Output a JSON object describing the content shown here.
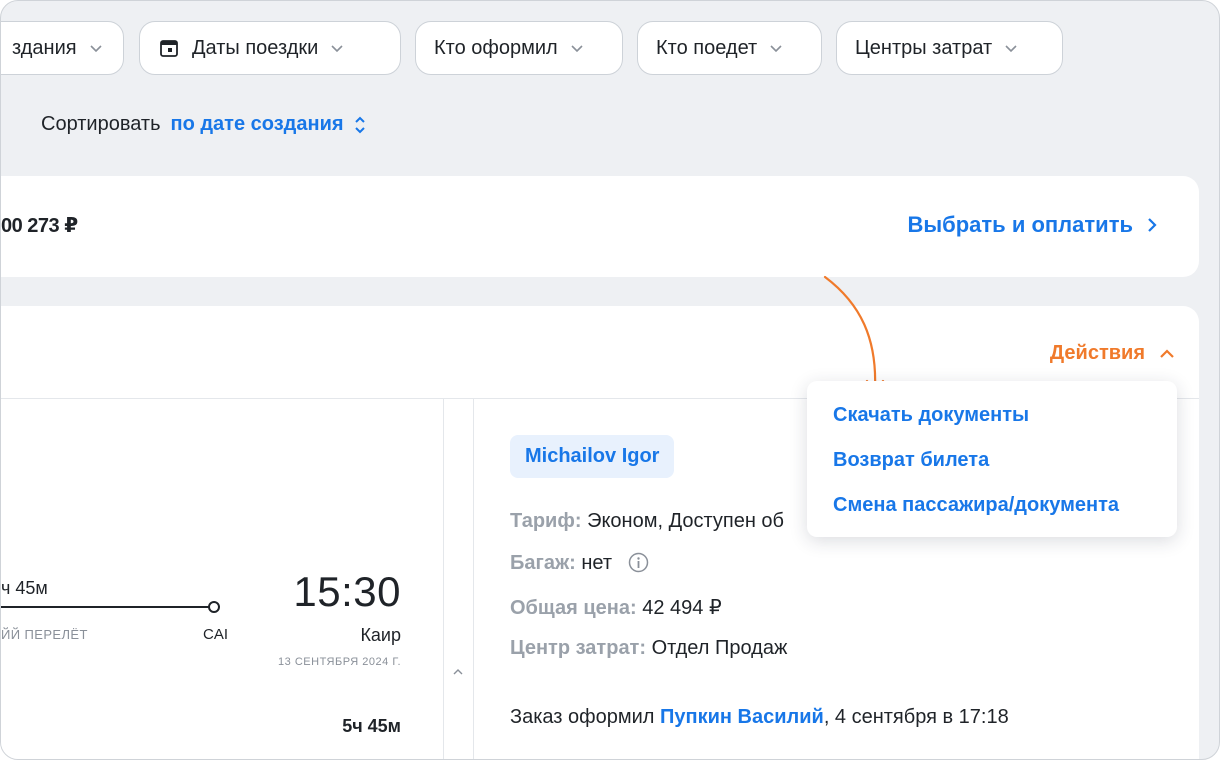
{
  "filters": [
    {
      "label": "здания",
      "icon": "chevron-down-icon"
    },
    {
      "label": "Даты поездки",
      "icon": "calendar-icon"
    },
    {
      "label": "Кто оформил",
      "icon": "chevron-down-icon"
    },
    {
      "label": "Кто поедет",
      "icon": "chevron-down-icon"
    },
    {
      "label": "Центры затрат",
      "icon": "chevron-down-icon"
    }
  ],
  "sort": {
    "label": "Сортировать",
    "value": "по дате создания"
  },
  "offer": {
    "price": "00 273 ₽",
    "pay_label": "Выбрать и оплатить"
  },
  "order_card": {
    "actions_label": "Действия",
    "menu": [
      "Скачать документы",
      "Возврат билета",
      "Смена пассажира/документа"
    ],
    "flight": {
      "duration_partial": "ч 45м",
      "note": "ЙЙ ПЕРЕЛЁТ",
      "arrival_iata": "CAI",
      "arrival_time": "15:30",
      "arrival_city": "Каир",
      "arrival_date": "13 СЕНТЯБРЯ 2024 Г.",
      "total_duration": "5ч 45м"
    },
    "passenger": "Michailov Igor",
    "details": {
      "tariff_key": "Тариф:",
      "tariff_val": "Эконом, Доступен об",
      "baggage_key": "Багаж:",
      "baggage_val": "нет",
      "price_key": "Общая цена:",
      "price_val": "42 494 ₽",
      "cost_center_key": "Центр затрат:",
      "cost_center_val": "Отдел Продаж"
    },
    "order_info": {
      "prefix": "Заказ оформил",
      "name": "Пупкин Василий",
      "suffix": ", 4 сентября в 17:18"
    }
  },
  "colors": {
    "accent": "#1877e8",
    "actions": "#f07a2b",
    "background": "#eef0f3"
  }
}
